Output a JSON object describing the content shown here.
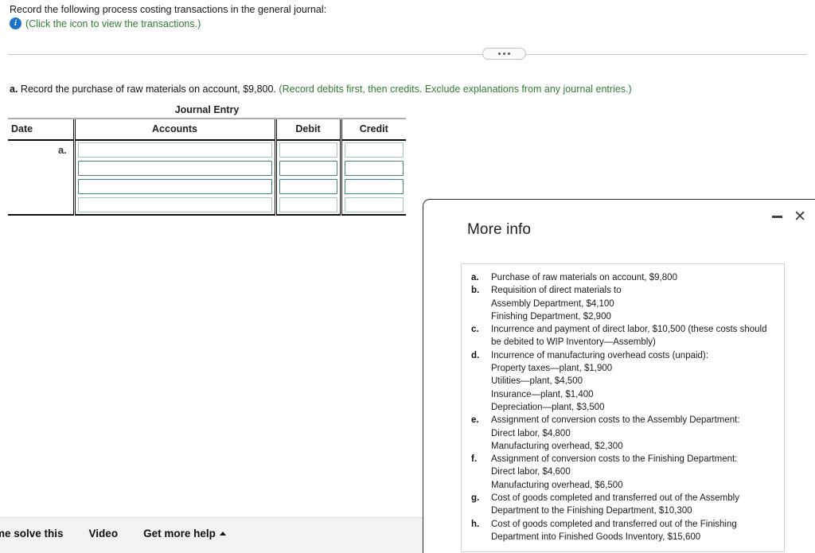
{
  "question": {
    "intro": "Record the following process costing transactions in the general journal:",
    "icon_name": "info-icon",
    "icon_link_text": "(Click the icon to view the transactions.)",
    "part_label": "a.",
    "part_text": "Record the purchase of raw materials on account, $9,800.",
    "part_hint": "(Record debits first, then credits. Exclude explanations from any journal entries.)"
  },
  "journal": {
    "title": "Journal Entry",
    "columns": [
      "Date",
      "Accounts",
      "Debit",
      "Credit"
    ],
    "rows": [
      {
        "date": "a.",
        "accounts": "",
        "debit": "",
        "credit": ""
      },
      {
        "date": "",
        "accounts": "",
        "debit": "",
        "credit": ""
      },
      {
        "date": "",
        "accounts": "",
        "debit": "",
        "credit": ""
      },
      {
        "date": "",
        "accounts": "",
        "debit": "",
        "credit": ""
      }
    ]
  },
  "footer": {
    "help_me_solve": "p me solve this",
    "video": "Video",
    "get_more_help": "Get more help",
    "caret_name": "caret-up-icon"
  },
  "modal": {
    "title": "More info",
    "minimize_name": "minimize-button",
    "close_name": "close-button",
    "items": [
      {
        "key": "a.",
        "text": "Purchase of raw materials on account, $9,800",
        "sub": []
      },
      {
        "key": "b.",
        "text": "Requisition of direct materials to",
        "sub": [
          "Assembly Department, $4,100",
          "Finishing Department, $2,900"
        ]
      },
      {
        "key": "c.",
        "text": "Incurrence and payment of direct labor, $10,500 (these costs should be debited to WIP Inventory—Assembly)",
        "sub": []
      },
      {
        "key": "d.",
        "text": "Incurrence of manufacturing overhead costs (unpaid):",
        "sub": [
          "Property taxes—plant, $1,900",
          "Utilities—plant, $4,500",
          "Insurance—plant, $1,400",
          "Depreciation—plant, $3,500"
        ]
      },
      {
        "key": "e.",
        "text": "Assignment of conversion costs to the Assembly Department:",
        "sub": [
          "Direct labor, $4,800",
          "Manufacturing overhead, $2,300"
        ]
      },
      {
        "key": "f.",
        "text": "Assignment of conversion costs to the Finishing Department:",
        "sub": [
          "Direct labor, $4,600",
          "Manufacturing overhead, $6,500"
        ]
      },
      {
        "key": "g.",
        "text": "Cost of goods completed and transferred out of the Assembly Department to the Finishing Department, $10,300",
        "sub": []
      },
      {
        "key": "h.",
        "text": "Cost of goods completed and transferred out of the Finishing Department into Finished Goods Inventory, $15,600",
        "sub": []
      }
    ]
  },
  "colors": {
    "hint_green": "#2e7d32",
    "info_blue": "#1a73c8",
    "input_border": "#3f7f7f",
    "footer_bg": "#f2f2f2"
  }
}
